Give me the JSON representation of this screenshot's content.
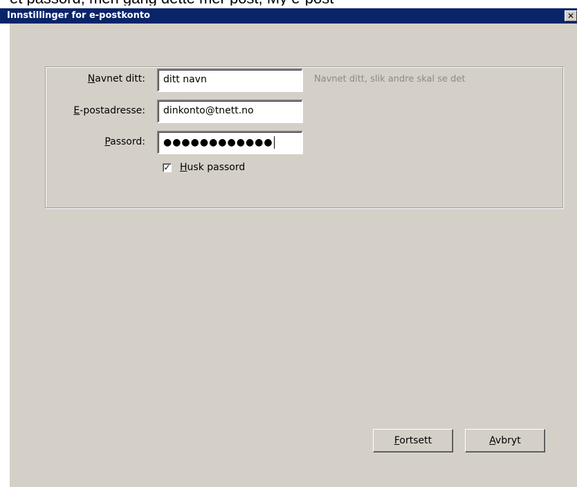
{
  "behind_text": "et passord, men gang dette mer post, My e-post",
  "window": {
    "title": "Innstillinger for e-postkonto",
    "close_glyph": "✕"
  },
  "form": {
    "name_label_underlined": "N",
    "name_label_rest": "avnet ditt:",
    "name_value": "ditt navn",
    "name_hint": "Navnet ditt, slik andre skal se det",
    "email_label_underlined": "E",
    "email_label_rest": "-postadresse:",
    "email_value": "dinkonto@tnett.no",
    "password_label_underlined": "P",
    "password_label_rest": "assord:",
    "password_mask": "●●●●●●●●●●●●",
    "remember_checked_glyph": "✓",
    "remember_label_underlined": "H",
    "remember_label_rest": "usk passord"
  },
  "buttons": {
    "continue_underlined": "F",
    "continue_rest": "ortsett",
    "cancel_underlined": "A",
    "cancel_rest": "vbryt"
  }
}
